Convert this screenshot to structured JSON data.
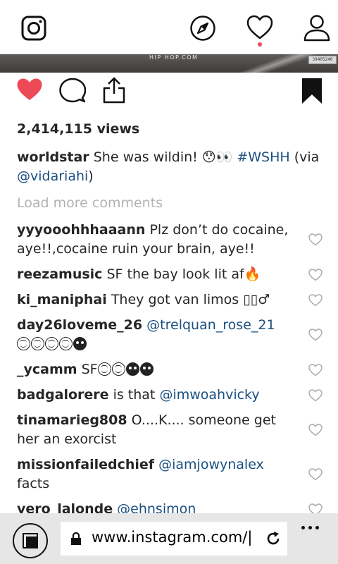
{
  "post": {
    "watermark": "HIP HOP.COM",
    "badge": "39405240",
    "views": "2,414,115 views",
    "caption": {
      "user": "worldstar",
      "text": "She was wildin! 😯👀",
      "hashtag": "#WSHH",
      "via_prefix": "(via",
      "mention": "@vidariahi",
      "via_suffix": ")"
    },
    "load_more": "Load more comments"
  },
  "comments": [
    {
      "user": "yyyooohhhaaann",
      "text": "Plz don’t do cocaine, aye!!,cocaine ruin your brain, aye!!"
    },
    {
      "user": "reezamusic",
      "text": "SF the bay look lit af🔥"
    },
    {
      "user": "ki_maniphai",
      "text": "They got van limos ▯▯♂"
    },
    {
      "user": "day26loveme_26",
      "mention": "@trelquan_rose_21",
      "emoji": [
        "joy",
        "joy",
        "joy",
        "joy",
        "skull"
      ]
    },
    {
      "user": "_ycamm",
      "text": "SF",
      "emoji": [
        "joy",
        "joy",
        "skull",
        "skull"
      ]
    },
    {
      "user": "badgalorere",
      "text": "is that",
      "mention": "@imwoahvicky"
    },
    {
      "user": "tinamarieg808",
      "text": "O....K.... someone get her an exorcist"
    },
    {
      "user": "missionfailedchief",
      "mention": "@iamjowynalex",
      "text_after": "facts"
    },
    {
      "user": "vero_lalonde",
      "mention": "@ehnsimon"
    }
  ],
  "browser": {
    "url": "www.instagram.com/|"
  },
  "colors": {
    "like_red": "#ed4956",
    "link_blue": "#1a4f80",
    "muted": "#b2b2b2"
  },
  "icons": [
    "instagram-icon",
    "compass-icon",
    "heart-icon",
    "person-icon",
    "like-icon",
    "comment-icon",
    "share-icon",
    "bookmark-icon",
    "lock-icon",
    "reload-icon",
    "tabs-icon",
    "more-icon"
  ]
}
